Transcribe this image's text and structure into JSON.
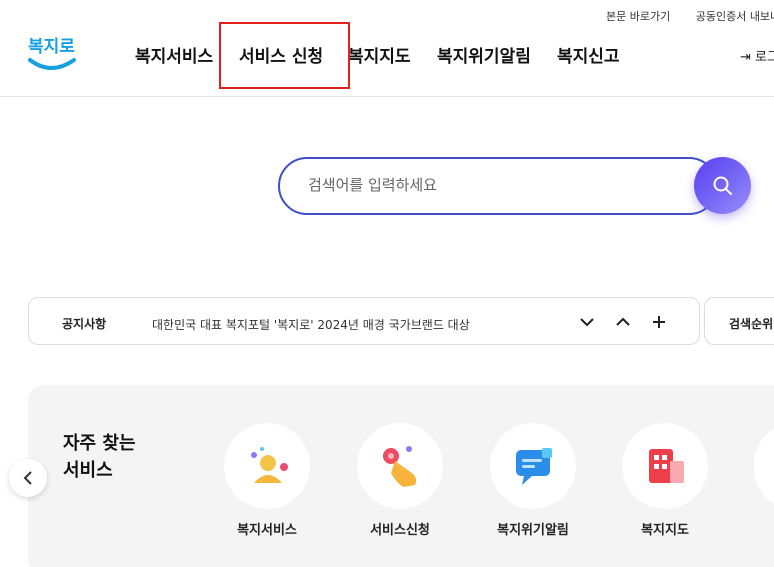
{
  "utility": {
    "skip_link": "본문 바로가기",
    "cert_link": "공동인증서 내보내"
  },
  "logo": {
    "text": "복지로"
  },
  "gnb": [
    {
      "label": "복지서비스"
    },
    {
      "label": "서비스 신청"
    },
    {
      "label": "복지지도"
    },
    {
      "label": "복지위기알림"
    },
    {
      "label": "복지신고"
    }
  ],
  "login": {
    "label": "로그"
  },
  "search": {
    "placeholder": "검색어를 입력하세요",
    "icon": "search-icon"
  },
  "notice": {
    "label": "공지사항",
    "text": "대한민국 대표 복지포털 '복지로' 2024년 매경 국가브랜드 대상",
    "controls": [
      "chevron-down-icon",
      "chevron-up-icon",
      "plus-icon"
    ]
  },
  "ranking": {
    "label": "검색순위"
  },
  "favorites": {
    "title_line1": "자주 찾는",
    "title_line2": "서비스",
    "items": [
      {
        "label": "복지서비스",
        "icon": "people-icon"
      },
      {
        "label": "서비스신청",
        "icon": "tap-hand-icon"
      },
      {
        "label": "복지위기알림",
        "icon": "chat-bubble-icon"
      },
      {
        "label": "복지지도",
        "icon": "map-building-icon"
      }
    ]
  },
  "colors": {
    "accent": "#3e4fc8",
    "search_button": "#6a52f2",
    "highlight": "#e0211d",
    "logo": "#1a9fe0"
  }
}
